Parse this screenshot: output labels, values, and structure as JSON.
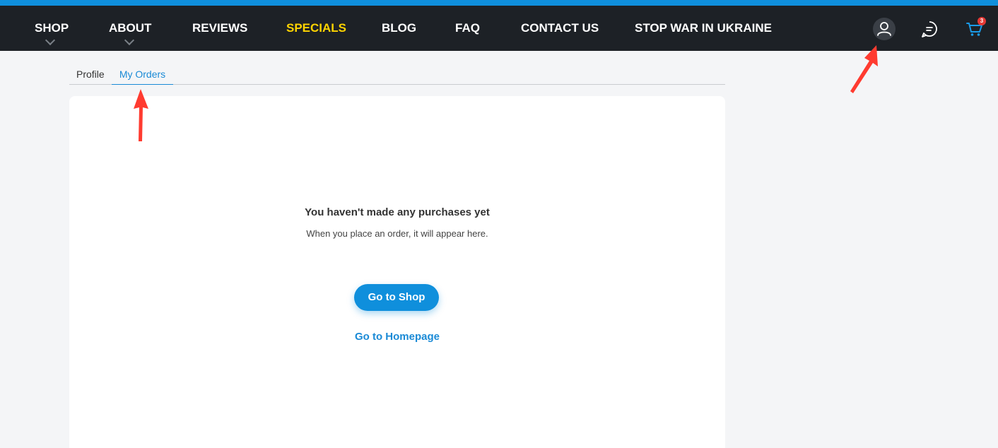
{
  "nav": {
    "items": [
      {
        "label": "SHOP"
      },
      {
        "label": "ABOUT"
      },
      {
        "label": "REVIEWS"
      },
      {
        "label": "SPECIALS"
      },
      {
        "label": "BLOG"
      },
      {
        "label": "FAQ"
      },
      {
        "label": "CONTACT US"
      },
      {
        "label": "STOP WAR IN UKRAINE"
      }
    ],
    "cart_count": "3"
  },
  "tabs": {
    "profile": "Profile",
    "orders": "My Orders"
  },
  "orders": {
    "empty_title": "You haven't made any purchases yet",
    "empty_subtitle": "When you place an order, it will appear here.",
    "shop_button": "Go to Shop",
    "home_link": "Go to Homepage"
  },
  "colors": {
    "accent": "#0f8fdc",
    "nav_bg": "#1d2126",
    "special": "#ffd400",
    "annotation": "#ff3b30"
  }
}
